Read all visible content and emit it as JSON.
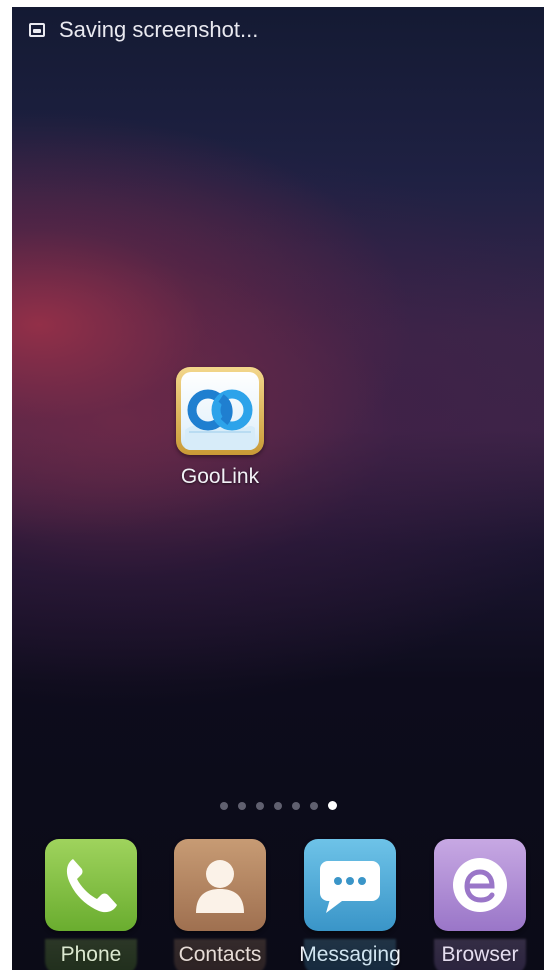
{
  "status_bar": {
    "notification_icon": "screenshot-icon",
    "notification_text": "Saving screenshot..."
  },
  "home_screen": {
    "shortcuts": [
      {
        "label": "GooLink",
        "icon": "goolink-icon"
      }
    ],
    "page_indicator": {
      "pages": 7,
      "active_page": 7
    }
  },
  "dock": {
    "items": [
      {
        "label": "Phone",
        "icon": "phone-icon",
        "color": "#7fc041"
      },
      {
        "label": "Contacts",
        "icon": "contacts-icon",
        "color": "#b48460"
      },
      {
        "label": "Messaging",
        "icon": "messaging-icon",
        "color": "#4fa9d9"
      },
      {
        "label": "Browser",
        "icon": "browser-icon",
        "color": "#b18fd6"
      }
    ]
  }
}
